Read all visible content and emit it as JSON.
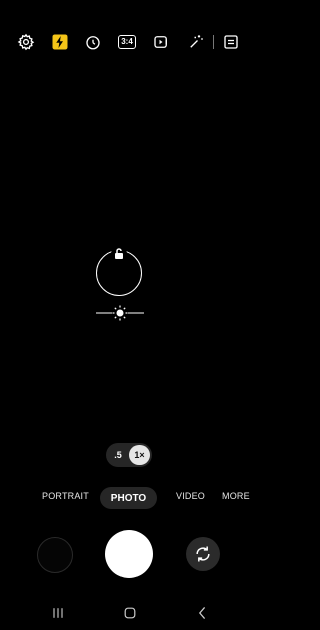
{
  "topbar": {
    "icons": [
      "settings-icon",
      "flash-icon",
      "timer-icon",
      "aspect-ratio-icon",
      "motion-photo-icon",
      "filter-icon",
      "gallery-preview-icon"
    ],
    "ratio_label": "3:4",
    "flash_color": "#f5c518"
  },
  "viewfinder": {
    "focus_lock_icon": "lock-open-icon",
    "exposure_icon": "sun-icon"
  },
  "zoom": {
    "half_label": ".5",
    "one_label": "1×"
  },
  "modes": {
    "portrait": "PORTRAIT",
    "photo": "PHOTO",
    "video": "VIDEO",
    "more": "MORE",
    "active": "PHOTO"
  },
  "controls": {
    "gallery_icon": "gallery-thumbnail",
    "shutter_icon": "shutter-button",
    "flip_icon": "camera-switch-icon"
  },
  "navbar": {
    "icons": [
      "recent-apps-icon",
      "home-icon",
      "back-icon"
    ]
  }
}
